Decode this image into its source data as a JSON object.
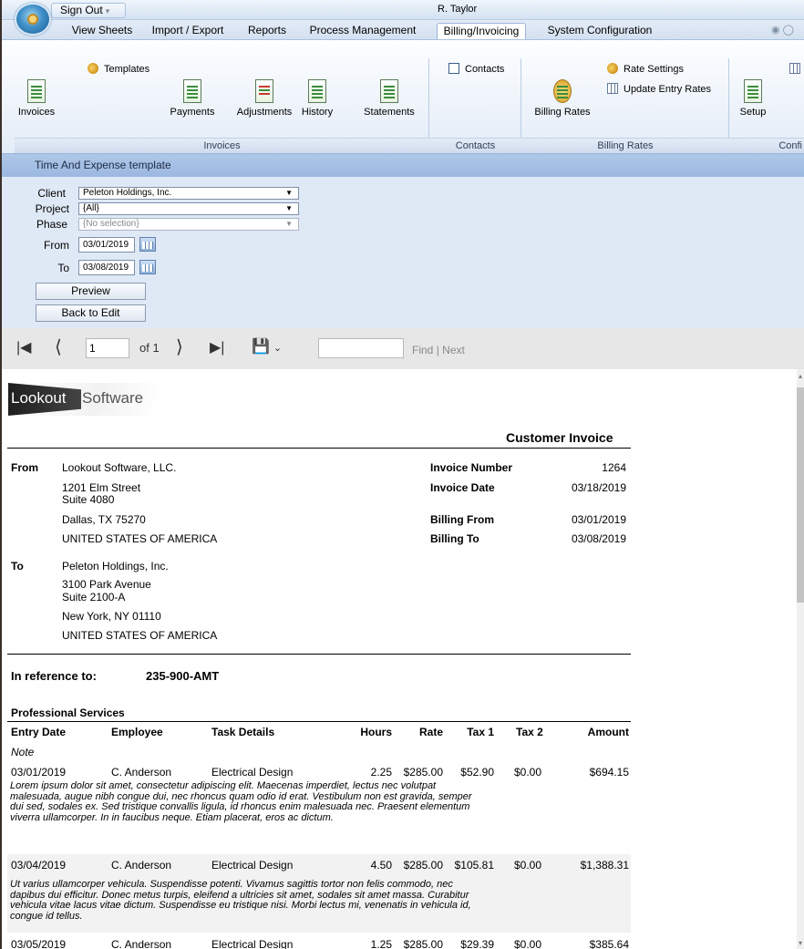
{
  "titlebar": {
    "signout_label": "Sign Out",
    "user": "R. Taylor"
  },
  "tabs": [
    "View Sheets",
    "Import / Export",
    "Reports",
    "Process Management",
    "Billing/Invoicing",
    "System Configuration"
  ],
  "ribbon": {
    "invoices_group": {
      "templates": "Templates",
      "invoices": "Invoices",
      "payments": "Payments",
      "adjustments": "Adjustments",
      "history": "History",
      "statements": "Statements",
      "label": "Invoices"
    },
    "contacts_group": {
      "contacts": "Contacts",
      "label": "Contacts"
    },
    "billing_rates_group": {
      "rate_settings": "Rate Settings",
      "update_entry_rates": "Update Entry Rates",
      "billing_rates": "Billing Rates",
      "label": "Billing Rates"
    },
    "config_group": {
      "setup": "Setup",
      "label": "Confi"
    }
  },
  "template_title": "Time And Expense template",
  "filters": {
    "client_label": "Client",
    "client_value": "Peleton Holdings, Inc.",
    "project_label": "Project",
    "project_value": "{All}",
    "phase_label": "Phase",
    "phase_value": "{No selection}",
    "from_label": "From",
    "from_value": "03/01/2019",
    "to_label": "To",
    "to_value": "03/08/2019",
    "preview": "Preview",
    "back_to_edit": "Back to Edit"
  },
  "toolbar": {
    "page": "1",
    "of": "of 1",
    "find": "Find",
    "sep": "|",
    "next": "Next"
  },
  "report": {
    "logo_bold": "Lookout",
    "logo_light": "Software",
    "title": "Customer Invoice",
    "from_label": "From",
    "from": {
      "name": "Lookout Software, LLC.",
      "addr1": "1201 Elm Street",
      "addr2": "Suite 4080",
      "city": "Dallas, TX 75270",
      "country": "UNITED STATES OF AMERICA"
    },
    "to_label": "To",
    "to": {
      "name": "Peleton Holdings, Inc.",
      "addr1": "3100 Park Avenue",
      "addr2": "Suite 2100-A",
      "city": "New York, NY 01110",
      "country": "UNITED STATES OF AMERICA"
    },
    "meta": {
      "invoice_number_label": "Invoice Number",
      "invoice_number": "1264",
      "invoice_date_label": "Invoice Date",
      "invoice_date": "03/18/2019",
      "billing_from_label": "Billing From",
      "billing_from": "03/01/2019",
      "billing_to_label": "Billing To",
      "billing_to": "03/08/2019"
    },
    "reference_label": "In reference to:",
    "reference": "235-900-AMT",
    "section": "Professional Services",
    "columns": {
      "entry_date": "Entry Date",
      "employee": "Employee",
      "task": "Task Details",
      "hours": "Hours",
      "rate": "Rate",
      "tax1": "Tax 1",
      "tax2": "Tax 2",
      "amount": "Amount",
      "note": "Note"
    },
    "rows": [
      {
        "date": "03/01/2019",
        "employee": "C. Anderson",
        "task": "Electrical Design",
        "hours": "2.25",
        "rate": "$285.00",
        "tax1": "$52.90",
        "tax2": "$0.00",
        "amount": "$694.15",
        "note": "Lorem ipsum dolor sit amet, consectetur adipiscing elit. Maecenas imperdiet, lectus nec volutpat malesuada, augue nibh congue dui, nec rhoncus quam odio id erat. Vestibulum non est gravida, semper dui sed, sodales ex. Sed tristique convallis ligula, id rhoncus enim malesuada nec. Praesent elementum viverra ullamcorper. In in faucibus neque. Etiam placerat, eros ac dictum."
      },
      {
        "date": "03/04/2019",
        "employee": "C. Anderson",
        "task": "Electrical Design",
        "hours": "4.50",
        "rate": "$285.00",
        "tax1": "$105.81",
        "tax2": "$0.00",
        "amount": "$1,388.31",
        "note": "Ut varius ullamcorper vehicula. Suspendisse potenti. Vivamus sagittis tortor non felis commodo, nec dapibus dui efficitur. Donec metus turpis, eleifend a ultricies sit amet, sodales sit amet massa. Curabitur vehicula vitae lacus vitae dictum. Suspendisse eu tristique nisi. Morbi lectus mi, venenatis in vehicula id, congue id tellus."
      },
      {
        "date": "03/05/2019",
        "employee": "C. Anderson",
        "task": "Electrical Design",
        "hours": "1.25",
        "rate": "$285.00",
        "tax1": "$29.39",
        "tax2": "$0.00",
        "amount": "$385.64"
      }
    ]
  }
}
